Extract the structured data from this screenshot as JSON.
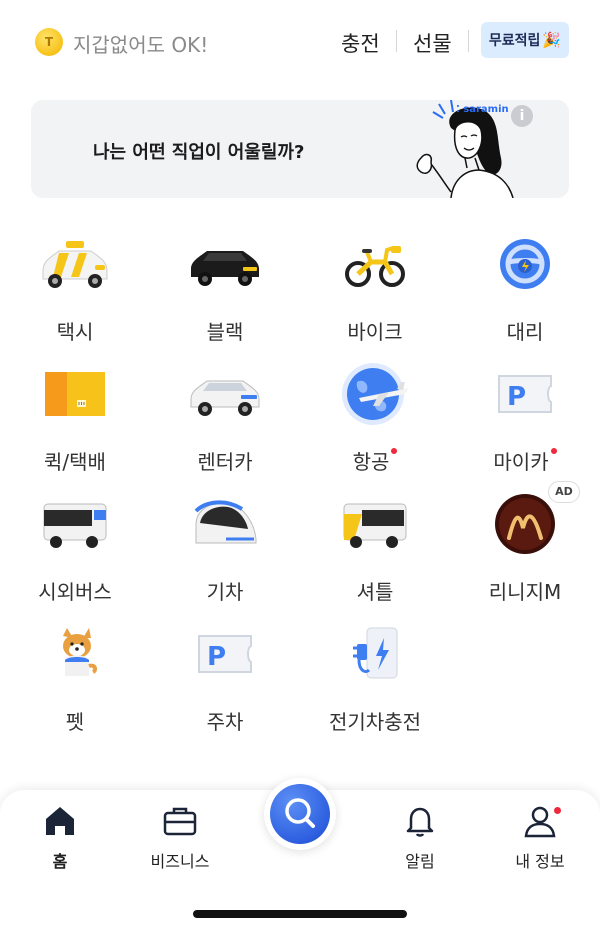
{
  "header": {
    "coin_symbol": "T",
    "wallet_text": "지갑없어도 OK!",
    "charge_label": "충전",
    "gift_label": "선물",
    "free_points_label": "무료적립",
    "free_points_emoji": "🎉"
  },
  "banner": {
    "text": "나는 어떤 직업이 어울릴까?",
    "brand": "saramin",
    "info_symbol": "i"
  },
  "services": [
    {
      "label": "택시",
      "icon": "taxi-icon",
      "new": false
    },
    {
      "label": "블랙",
      "icon": "black-car-icon",
      "new": false
    },
    {
      "label": "바이크",
      "icon": "bike-icon",
      "new": false
    },
    {
      "label": "대리",
      "icon": "steering-wheel-icon",
      "new": false
    },
    {
      "label": "퀵/택배",
      "icon": "package-icon",
      "new": false
    },
    {
      "label": "렌터카",
      "icon": "rental-car-icon",
      "new": false
    },
    {
      "label": "항공",
      "icon": "airplane-globe-icon",
      "new": true
    },
    {
      "label": "마이카",
      "icon": "parking-ticket-icon",
      "new": true
    },
    {
      "label": "시외버스",
      "icon": "bus-icon",
      "new": false
    },
    {
      "label": "기차",
      "icon": "train-icon",
      "new": false
    },
    {
      "label": "셔틀",
      "icon": "shuttle-icon",
      "new": false
    },
    {
      "label": "리니지M",
      "icon": "lineage-logo-icon",
      "new": false,
      "ad": "AD"
    },
    {
      "label": "펫",
      "icon": "dog-icon",
      "new": false
    },
    {
      "label": "주차",
      "icon": "parking-ticket-icon",
      "new": false
    },
    {
      "label": "전기차충전",
      "icon": "ev-charger-icon",
      "new": false
    }
  ],
  "bottom_nav": [
    {
      "label": "홈",
      "icon": "home-icon",
      "active": true
    },
    {
      "label": "비즈니스",
      "icon": "briefcase-icon",
      "active": false
    },
    {
      "label": "",
      "icon": "search-icon",
      "active": false
    },
    {
      "label": "알림",
      "icon": "bell-icon",
      "active": false
    },
    {
      "label": "내 정보",
      "icon": "person-icon",
      "active": false,
      "badge": true
    }
  ],
  "colors": {
    "accent_blue": "#2d5fe0",
    "notification_red": "#f0283c",
    "taxi_yellow": "#f5c518"
  }
}
